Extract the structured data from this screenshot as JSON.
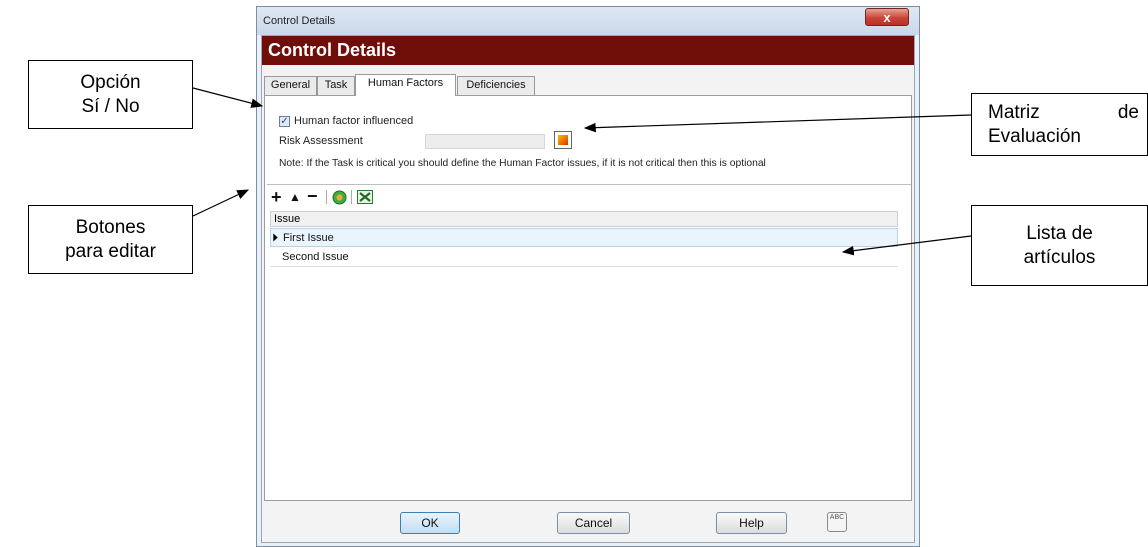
{
  "callouts": {
    "yes_no": [
      "Opción",
      "Sí / No"
    ],
    "edit_buttons": [
      "Botones",
      "para editar"
    ],
    "matrix": [
      "Matriz",
      "de",
      "Evaluación"
    ],
    "list": [
      "Lista de",
      "artículos"
    ]
  },
  "window": {
    "title": "Control Details",
    "close_glyph": "x",
    "header": "Control Details"
  },
  "tabs": [
    {
      "label": "General"
    },
    {
      "label": "Task"
    },
    {
      "label": "Human Factors",
      "active": true
    },
    {
      "label": "Deficiencies"
    }
  ],
  "human_factors": {
    "checkbox_label": "Human factor influenced",
    "checkbox_checked": true,
    "checkbox_glyph": "✓",
    "risk_label": "Risk Assessment",
    "risk_value": "",
    "note": "Note: If the Task is critical you should define the Human Factor issues, if  it is not critical then this is optional"
  },
  "toolbar": {
    "add_glyph": "+",
    "up_glyph": "▲",
    "remove_glyph": "−"
  },
  "grid": {
    "column_header": "Issue",
    "rows": [
      {
        "text": "First Issue",
        "selected": true
      },
      {
        "text": "Second Issue",
        "selected": false
      }
    ]
  },
  "footer": {
    "ok": "OK",
    "cancel": "Cancel",
    "help": "Help",
    "spell_glyph": "ABC"
  },
  "colors": {
    "header_bg": "#6f0d09",
    "close_button": "#c8463a",
    "arrow": "#000000"
  },
  "icons": [
    "add-icon",
    "move-up-icon",
    "remove-icon",
    "refresh-icon",
    "excel-icon",
    "risk-matrix-icon",
    "spellcheck-icon",
    "close-icon",
    "checkmark-icon",
    "row-pointer-icon"
  ]
}
